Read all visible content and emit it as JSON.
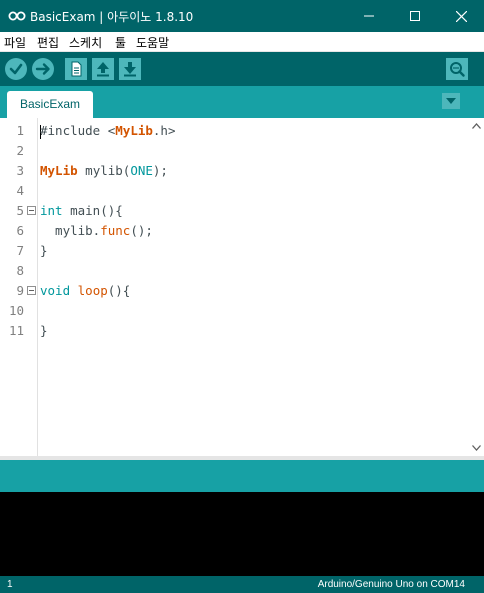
{
  "window": {
    "title": "BasicExam | 아두이노 1.8.10"
  },
  "menu": {
    "items": [
      "파일",
      "편집",
      "스케치",
      "툴",
      "도움말"
    ]
  },
  "toolbar": {
    "buttons": [
      "verify-icon",
      "upload-icon",
      "new-icon",
      "open-icon",
      "save-icon"
    ],
    "serial_monitor": "serial-monitor-icon"
  },
  "tabs": [
    {
      "label": "BasicExam",
      "active": true
    }
  ],
  "editor": {
    "line_numbers": [
      "1",
      "2",
      "3",
      "4",
      "5",
      "6",
      "7",
      "8",
      "9",
      "10",
      "11"
    ],
    "code": {
      "l1_hash": "#include ",
      "l1_lt": "<",
      "l1_lib": "MyLib",
      "l1_rest": ".h>",
      "l3_class": "MyLib",
      "l3_mid": " mylib(",
      "l3_const": "ONE",
      "l3_end": ");",
      "l5_type": "int",
      "l5_rest": " main(){",
      "l6_obj": "  mylib.",
      "l6_func": "func",
      "l6_end": "();",
      "l7": "}",
      "l9_type": "void",
      "l9_space": " ",
      "l9_func": "loop",
      "l9_end": "(){",
      "l11": "}"
    }
  },
  "status": {
    "line": "1",
    "board": "Arduino/Genuino Uno on COM14"
  },
  "colors": {
    "titlebar": "#006468",
    "toolbar": "#006468",
    "tabbar": "#17a1a5",
    "button": "#4db7bb",
    "keyword": "#00979c",
    "function": "#d35400"
  }
}
